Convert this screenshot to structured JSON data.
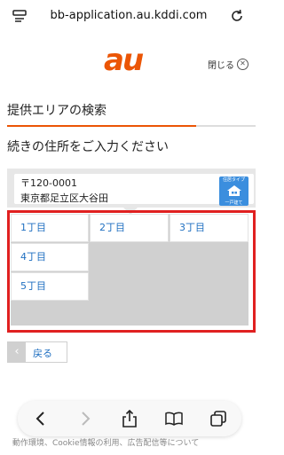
{
  "browser": {
    "url": "bb-application.au.kddi.com",
    "icons": [
      "reader-icon",
      "reload-icon"
    ]
  },
  "header": {
    "logo": "au",
    "close_label": "閉じる",
    "close_icon": "close-circle-icon"
  },
  "page": {
    "title": "提供エリアの検索",
    "progress_percent": 76,
    "instruction": "続きの住所をご入力ください"
  },
  "address": {
    "postal": "〒120-0001",
    "address_text": "東京都足立区大谷田",
    "badge_top": "住居タイプ",
    "badge_bottom": "一戸建て",
    "badge_icon": "house-icon"
  },
  "chome_options": [
    "1丁目",
    "2丁目",
    "3丁目",
    "4丁目",
    "5丁目"
  ],
  "back_button": {
    "label": "戻る",
    "icon": "chevron-left-icon"
  },
  "footer": {
    "partial_text": "動作環境、Cookie情報の利用、広告配信等について"
  },
  "toolbar": {
    "icons": [
      "back-icon",
      "forward-icon",
      "share-icon",
      "bookmarks-icon",
      "tabs-icon"
    ]
  },
  "colors": {
    "brand": "#eb5505",
    "link": "#1f6fc1",
    "highlight_frame": "#e02020",
    "badge": "#3b8ede"
  }
}
